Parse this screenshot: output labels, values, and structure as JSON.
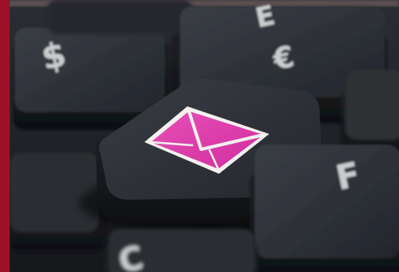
{
  "scene": {
    "keys": {
      "dollar": {
        "glyph": "$"
      },
      "e_key": {
        "glyph": "E"
      },
      "euro": {
        "glyph": "€"
      },
      "f_key": {
        "glyph": "F"
      },
      "c_key": {
        "glyph": "C"
      }
    },
    "colors": {
      "left_stripe": "#9d1028",
      "key_top": "#2b2e33",
      "key_shadow": "#111214",
      "envelope": "#e43fae",
      "envelope_border": "#f3f0ee",
      "top_band": "#6b5a5b"
    },
    "icons": {
      "center_key": "envelope-icon"
    }
  }
}
